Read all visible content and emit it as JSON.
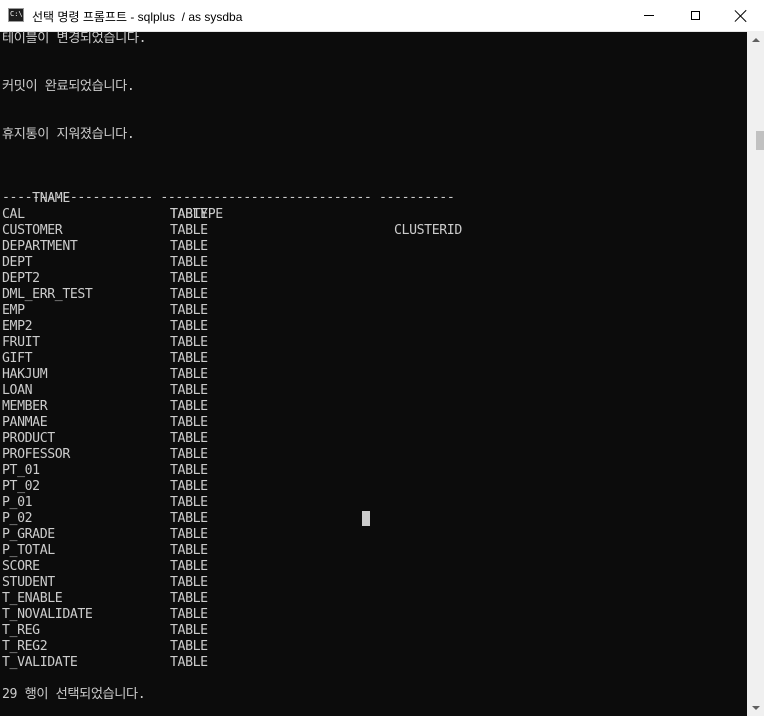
{
  "window": {
    "title": "선택 명령 프롬프트 - sqlplus  / as sysdba",
    "icon": "cmd-icon",
    "controls": [
      "minimize",
      "maximize",
      "close"
    ]
  },
  "console": {
    "messages": {
      "table_changed": "테이블이 변경되었습니다.",
      "commit_done": "커밋이 완료되었습니다.",
      "recyclebin_purged": "휴지통이 지워졌습니다.",
      "rows_selected": "29 행이 선택되었습니다."
    },
    "table": {
      "headers": [
        "TNAME",
        "TABTYPE",
        "CLUSTERID"
      ],
      "dashes": "-------------------- ---------------------------- ----------",
      "rows": [
        [
          "CAL",
          "TABLE"
        ],
        [
          "CUSTOMER",
          "TABLE"
        ],
        [
          "DEPARTMENT",
          "TABLE"
        ],
        [
          "DEPT",
          "TABLE"
        ],
        [
          "DEPT2",
          "TABLE"
        ],
        [
          "DML_ERR_TEST",
          "TABLE"
        ],
        [
          "EMP",
          "TABLE"
        ],
        [
          "EMP2",
          "TABLE"
        ],
        [
          "FRUIT",
          "TABLE"
        ],
        [
          "GIFT",
          "TABLE"
        ],
        [
          "HAKJUM",
          "TABLE"
        ],
        [
          "LOAN",
          "TABLE"
        ],
        [
          "MEMBER",
          "TABLE"
        ],
        [
          "PANMAE",
          "TABLE"
        ],
        [
          "PRODUCT",
          "TABLE"
        ],
        [
          "PROFESSOR",
          "TABLE"
        ],
        [
          "PT_01",
          "TABLE"
        ],
        [
          "PT_02",
          "TABLE"
        ],
        [
          "P_01",
          "TABLE"
        ],
        [
          "P_02",
          "TABLE"
        ],
        [
          "P_GRADE",
          "TABLE"
        ],
        [
          "P_TOTAL",
          "TABLE"
        ],
        [
          "SCORE",
          "TABLE"
        ],
        [
          "STUDENT",
          "TABLE"
        ],
        [
          "T_ENABLE",
          "TABLE"
        ],
        [
          "T_NOVALIDATE",
          "TABLE"
        ],
        [
          "T_REG",
          "TABLE"
        ],
        [
          "T_REG2",
          "TABLE"
        ],
        [
          "T_VALIDATE",
          "TABLE"
        ]
      ]
    }
  },
  "colors": {
    "console_bg": "#0c0c0c",
    "console_text": "#cccccc",
    "titlebar_bg": "#ffffff"
  }
}
